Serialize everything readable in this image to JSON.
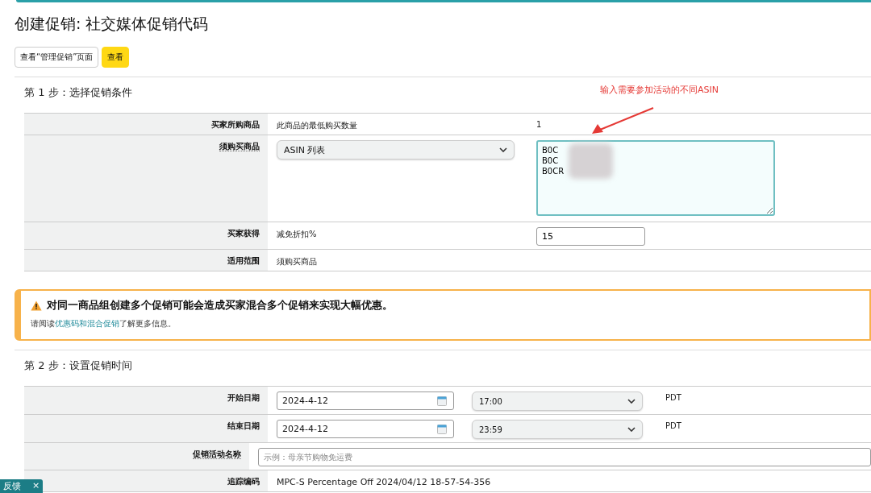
{
  "page": {
    "title": "创建促销: 社交媒体促销代码"
  },
  "buttons": [
    {
      "label": "查看“管理促销”页面",
      "kind": "secondary"
    },
    {
      "label": "查看",
      "kind": "primary"
    }
  ],
  "step1": {
    "heading": "第 1 步：选择促销条件",
    "rows": [
      {
        "kind": "text3",
        "label": "买家所购商品",
        "value": "此商品的最低购买数量",
        "extra": "1",
        "dotted": false
      },
      {
        "kind": "select-textarea",
        "label": "须购买商品",
        "value": "ASIN 列表",
        "textarea": "B0C\nB0C\nB0CR",
        "dotted": true
      },
      {
        "kind": "text-input",
        "label": "买家获得",
        "value": "减免折扣%",
        "input": "15",
        "dotted": false
      },
      {
        "kind": "text",
        "label": "适用范围",
        "value": "须购买商品",
        "dotted": false
      }
    ]
  },
  "annotation": {
    "text": "输入需要参加活动的不同ASIN"
  },
  "alert": {
    "title": "对同一商品组创建多个促销可能会造成买家混合多个促销来实现大幅优惠。",
    "before": "请阅读",
    "link": "优惠码和混合促销",
    "after": "了解更多信息。"
  },
  "step2": {
    "heading": "第 2 步：设置促销时间",
    "rows": [
      {
        "kind": "datetime",
        "label": "开始日期",
        "date": "2024-4-12",
        "time": "17:00",
        "zone": "PDT",
        "dotted": false
      },
      {
        "kind": "datetime",
        "label": "结束日期",
        "date": "2024-4-12",
        "time": "23:59",
        "zone": "PDT",
        "dotted": false
      },
      {
        "kind": "input",
        "label": "促销活动名称",
        "placeholder": "示例：母亲节购物免运费",
        "dotted": true
      },
      {
        "kind": "text",
        "label": "追踪编码",
        "value": "MPC-S Percentage Off 2024/04/12 18-57-54-356",
        "dotted": false
      }
    ]
  },
  "feedback": {
    "label": "反馈",
    "close": "×"
  }
}
